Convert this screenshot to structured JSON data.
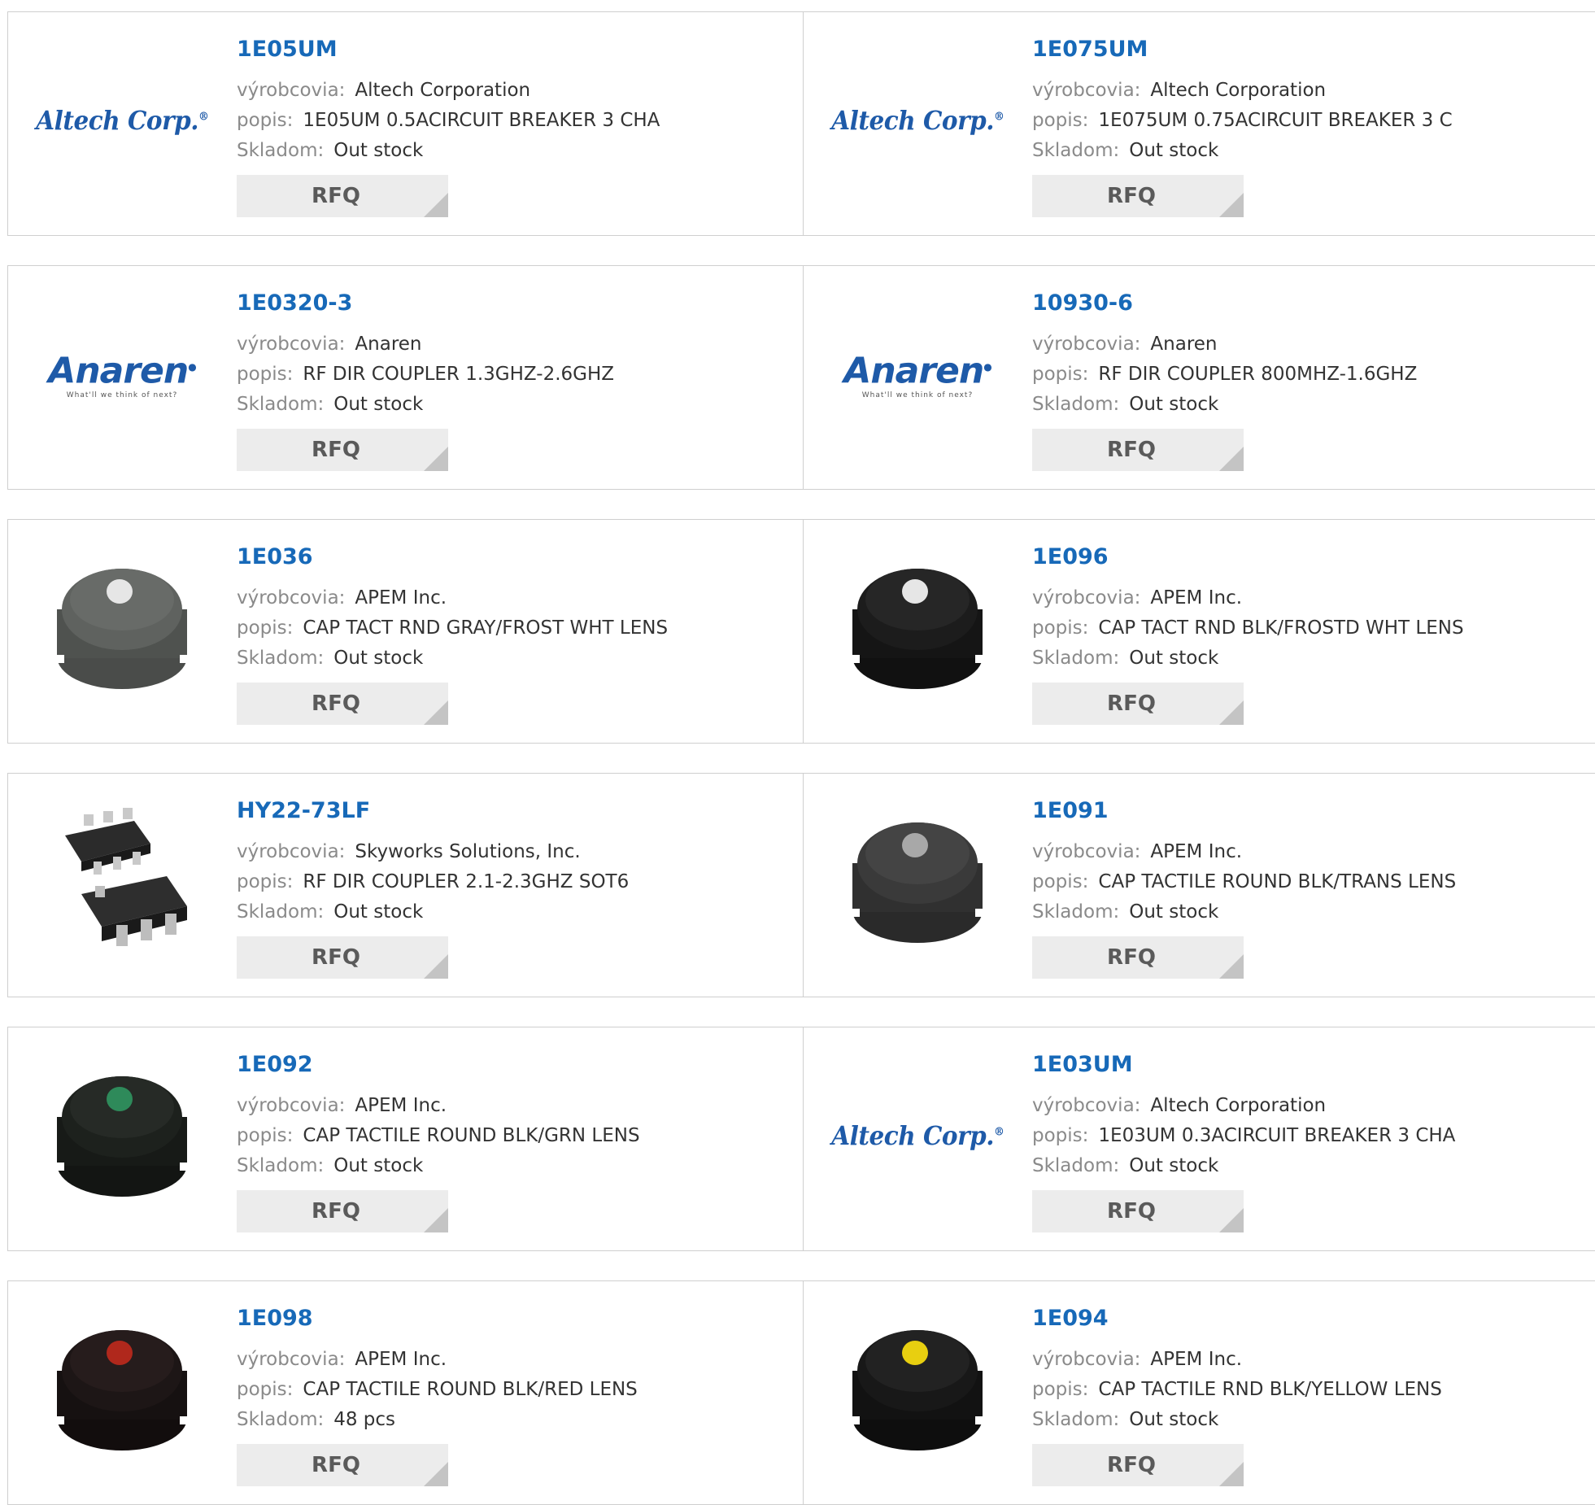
{
  "labels": {
    "manufacturer": "výrobcovia:",
    "description": "popis:",
    "stock": "Skladom:",
    "rfq": "RFQ"
  },
  "products": [
    {
      "part": "1E05UM",
      "manufacturer": "Altech Corporation",
      "description": "1E05UM 0.5ACIRCUIT BREAKER 3 CHA",
      "stock": "Out stock",
      "logo": "Altech Corp."
    },
    {
      "part": "1E075UM",
      "manufacturer": "Altech Corporation",
      "description": "1E075UM 0.75ACIRCUIT BREAKER 3 C",
      "stock": "Out stock",
      "logo": "Altech Corp."
    },
    {
      "part": "1E0320-3",
      "manufacturer": "Anaren",
      "description": "RF DIR COUPLER 1.3GHZ-2.6GHZ",
      "stock": "Out stock",
      "logo": "Anaren",
      "logo_tag": "What'll we think of next?"
    },
    {
      "part": "10930-6",
      "manufacturer": "Anaren",
      "description": "RF DIR COUPLER 800MHZ-1.6GHZ",
      "stock": "Out stock",
      "logo": "Anaren",
      "logo_tag": "What'll we think of next?"
    },
    {
      "part": "1E036",
      "manufacturer": "APEM Inc.",
      "description": "CAP TACT RND GRAY/FROST WHT LENS",
      "stock": "Out stock",
      "image": "gray-cap-white-lens"
    },
    {
      "part": "1E096",
      "manufacturer": "APEM Inc.",
      "description": "CAP TACT RND BLK/FROSTD WHT LENS",
      "stock": "Out stock",
      "image": "black-cap-white-lens"
    },
    {
      "part": "HY22-73LF",
      "manufacturer": "Skyworks Solutions, Inc.",
      "description": "RF DIR COUPLER 2.1-2.3GHZ SOT6",
      "stock": "Out stock",
      "image": "sot6-chip"
    },
    {
      "part": "1E091",
      "manufacturer": "APEM Inc.",
      "description": "CAP TACTILE ROUND BLK/TRANS LENS",
      "stock": "Out stock",
      "image": "dark-cap-trans-lens"
    },
    {
      "part": "1E092",
      "manufacturer": "APEM Inc.",
      "description": "CAP TACTILE ROUND BLK/GRN LENS",
      "stock": "Out stock",
      "image": "black-cap-green-lens"
    },
    {
      "part": "1E03UM",
      "manufacturer": "Altech Corporation",
      "description": "1E03UM 0.3ACIRCUIT BREAKER 3 CHA",
      "stock": "Out stock",
      "logo": "Altech Corp."
    },
    {
      "part": "1E098",
      "manufacturer": "APEM Inc.",
      "description": "CAP TACTILE ROUND BLK/RED LENS",
      "stock": "48 pcs",
      "image": "black-cap-red-lens"
    },
    {
      "part": "1E094",
      "manufacturer": "APEM Inc.",
      "description": "CAP TACTILE RND BLK/YELLOW LENS",
      "stock": "Out stock",
      "image": "black-cap-yellow-lens"
    }
  ],
  "colors": {
    "link": "#1769b8",
    "label": "#8a8a8a",
    "button_bg": "#ececec",
    "border": "#cfcfcf",
    "gray_cap": "#5f625f",
    "black_cap": "#1c1c1c",
    "dark_cap": "#3a3a3a",
    "lens_white": "#e6e6e6",
    "lens_trans": "#a8a8a8",
    "lens_green": "#2e8a5a",
    "lens_red": "#b0281c",
    "lens_yellow": "#e8cf10"
  }
}
